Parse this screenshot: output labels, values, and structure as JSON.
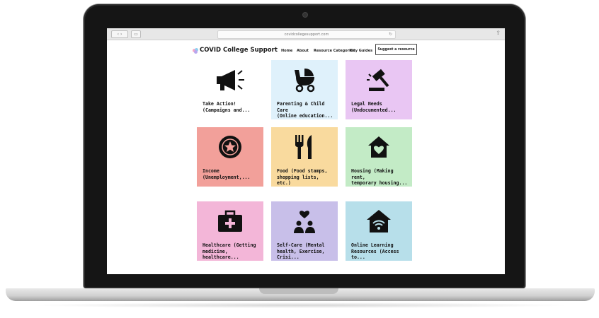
{
  "browser": {
    "url": "covidcollegesupport.com",
    "back_forward": "‹ ›",
    "sidebar_glyph": "▭",
    "reload_glyph": "↻",
    "share_glyph": "⇪"
  },
  "site": {
    "logo_text": "COVID College Support",
    "nav": [
      "Home",
      "About",
      "Resource Categories",
      "City Guides"
    ],
    "suggest_label": "Suggest a resource"
  },
  "tiles": [
    {
      "label": "Take Action!\n(Campaigns and...",
      "color": "#ffffff",
      "icon": "megaphone-icon"
    },
    {
      "label": "Parenting & Child Care\n(Online education...",
      "color": "#dff1fb",
      "icon": "stroller-icon"
    },
    {
      "label": "Legal Needs\n(Undocumented...",
      "color": "#e9c6f3",
      "icon": "gavel-icon"
    },
    {
      "label": "Income\n(Unemployment,...",
      "color": "#f2a09a",
      "icon": "coin-icon"
    },
    {
      "label": "Food (Food stamps,\nshopping lists, etc.)",
      "color": "#f9da9e",
      "icon": "utensils-icon"
    },
    {
      "label": "Housing (Making rent,\ntemporary housing...",
      "color": "#c3ebc6",
      "icon": "house-heart-icon"
    },
    {
      "label": "Healthcare (Getting\nmedicine, healthcare...",
      "color": "#f3b6d8",
      "icon": "medical-kit-icon"
    },
    {
      "label": "Self-Care (Mental\nhealth, Exercise, Crisi...",
      "color": "#c8bfe9",
      "icon": "self-care-icon"
    },
    {
      "label": "Online Learning\nResources (Access to...",
      "color": "#b7dfea",
      "icon": "house-wifi-icon"
    }
  ],
  "colors": {
    "icon": "#111111",
    "logo_dots": [
      "#f6a6c8",
      "#8fcff0",
      "#b9a6ee"
    ]
  }
}
